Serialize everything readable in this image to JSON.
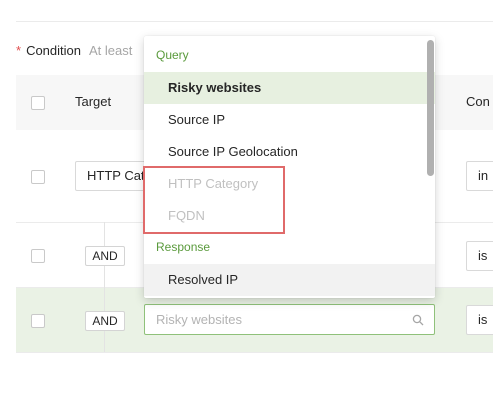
{
  "condition": {
    "required_mark": "*",
    "label": "Condition",
    "hint": "At least"
  },
  "table": {
    "headers": {
      "target": "Target",
      "condition": "Con"
    },
    "rows": [
      {
        "target_value": "HTTP Cat",
        "condition_value": "in"
      },
      {
        "connector": "AND",
        "condition_value": "is"
      },
      {
        "connector": "AND",
        "condition_value": "is"
      }
    ]
  },
  "search": {
    "placeholder": "Risky websites"
  },
  "dropdown": {
    "groups": [
      {
        "label": "Query",
        "options": [
          {
            "label": "Risky websites",
            "state": "selected"
          },
          {
            "label": "Source IP",
            "state": "normal"
          },
          {
            "label": "Source IP Geolocation",
            "state": "normal"
          },
          {
            "label": "HTTP Category",
            "state": "disabled"
          },
          {
            "label": "FQDN",
            "state": "disabled"
          }
        ]
      },
      {
        "label": "Response",
        "options": [
          {
            "label": "Resolved IP",
            "state": "hovered"
          }
        ]
      }
    ]
  },
  "colors": {
    "accent_green": "#5a9a3c",
    "selected_bg": "#e7f0e0",
    "highlight_box": "#e06a6a",
    "required_red": "#e04f4f"
  }
}
